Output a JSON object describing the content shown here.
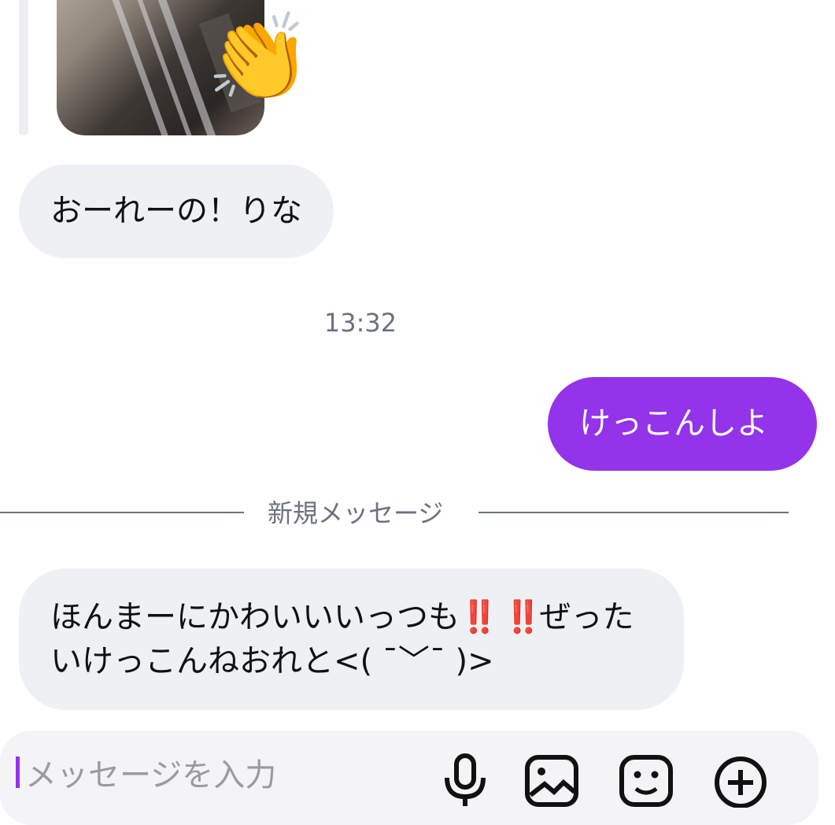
{
  "thread": {
    "messages": [
      {
        "direction": "incoming",
        "text": "おーれーの！りな"
      },
      {
        "direction": "outgoing",
        "text": "けっこんしよ"
      },
      {
        "direction": "incoming",
        "text_start": "ほんまーにかわいいいっつも",
        "emphasis": "‼️ ‼️",
        "text_end": "ぜったいけっこんねおれと<( ˉ﹀ˉ )>"
      }
    ],
    "attachment": {
      "emoji": "👏"
    },
    "timestamp": "13:32",
    "new_messages_label": "新規メッセージ"
  },
  "composer": {
    "placeholder": "メッセージを入力",
    "tools": [
      "microphone-icon",
      "image-icon",
      "sticker-icon",
      "add-icon"
    ]
  },
  "colors": {
    "accent": "#9333ea",
    "incoming_bubble": "#eef1f4",
    "secondary_text": "#6b7280",
    "emphasis": "#e11d1d"
  }
}
